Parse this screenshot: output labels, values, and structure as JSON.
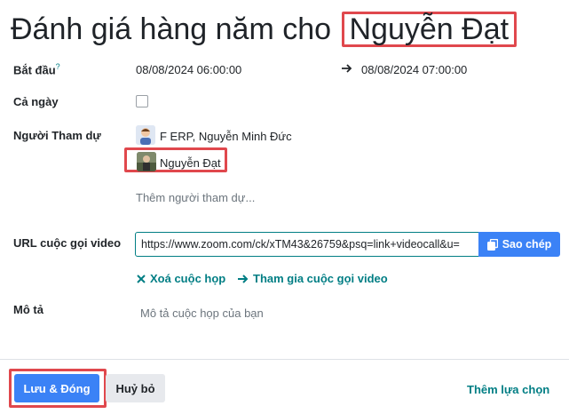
{
  "title": {
    "prefix": "Đánh giá hàng năm cho",
    "name": "Nguyễn Đạt"
  },
  "fields": {
    "start": {
      "label": "Bắt đầu",
      "help": "?",
      "start_value": "08/08/2024 06:00:00",
      "end_value": "08/08/2024 07:00:00"
    },
    "all_day": {
      "label": "Cả ngày",
      "checked": false
    },
    "attendees": {
      "label": "Người Tham dự",
      "items": [
        "F ERP, Nguyễn Minh Đức",
        "Nguyễn Đạt"
      ],
      "add_placeholder": "Thêm người tham dự..."
    },
    "video_url": {
      "label": "URL cuộc gọi video",
      "value": "https://www.zoom.com/ck/xTM43&26759&psq=link+videocall&u=",
      "copy_label": "Sao chép",
      "delete_label": "Xoá cuộc họp",
      "join_label": "Tham gia cuộc gọi video"
    },
    "description": {
      "label": "Mô tả",
      "placeholder": "Mô tả cuộc họp của bạn"
    }
  },
  "footer": {
    "save_label": "Lưu & Đóng",
    "cancel_label": "Huỷ bỏ",
    "more_label": "Thêm lựa chọn"
  },
  "colors": {
    "primary": "#3b82f6",
    "link": "#017e84",
    "highlight": "#e0484d"
  }
}
